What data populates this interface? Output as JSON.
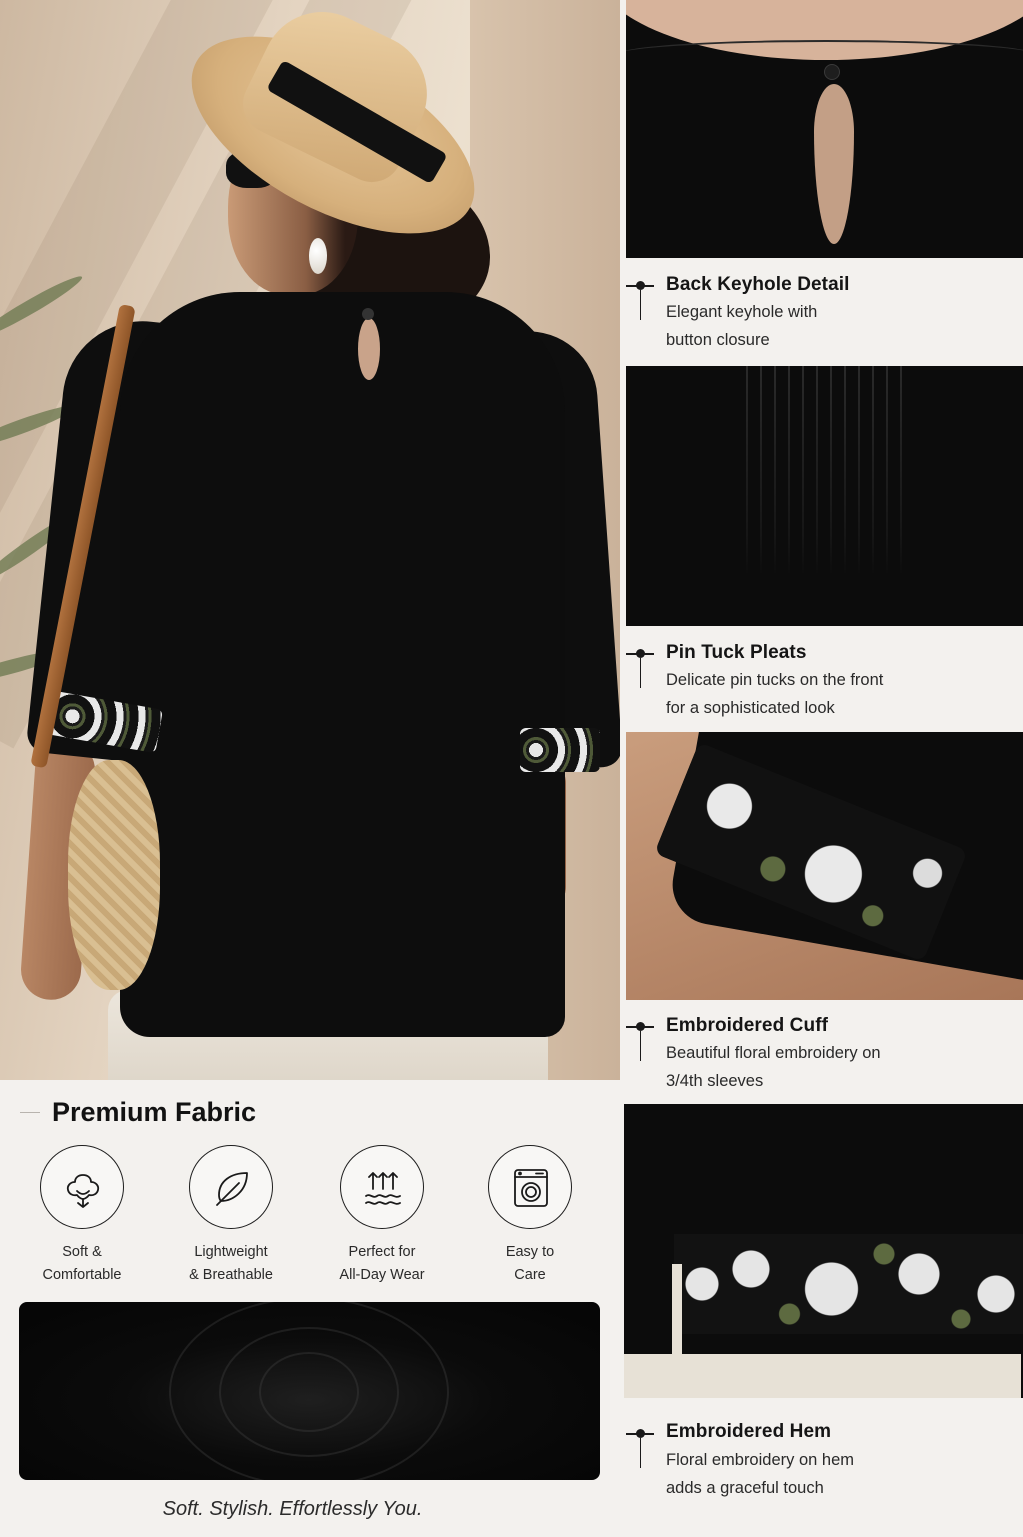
{
  "main_photo": {
    "description_icon": "woman-back-view-black-tunic"
  },
  "details": [
    {
      "title": "Back Keyhole Detail",
      "desc_line1": "Elegant keyhole with",
      "desc_line2": "button closure"
    },
    {
      "title": "Pin Tuck Pleats",
      "desc_line1": "Delicate pin tucks on the front",
      "desc_line2": "for a sophisticated look"
    },
    {
      "title": "Embroidered Cuff",
      "desc_line1": "Beautiful floral embroidery on",
      "desc_line2": "3/4th sleeves"
    },
    {
      "title": "Embroidered Hem",
      "desc_line1": "Floral embroidery on hem",
      "desc_line2": "adds a graceful touch"
    }
  ],
  "fabric": {
    "heading": "Premium Fabric",
    "features": [
      {
        "icon": "cotton-icon",
        "line1": "Soft &",
        "line2": "Comfortable"
      },
      {
        "icon": "leaf-icon",
        "line1": "Lightweight",
        "line2": "& Breathable"
      },
      {
        "icon": "airflow-icon",
        "line1": "Perfect for",
        "line2": "All-Day Wear"
      },
      {
        "icon": "washing-machine-icon",
        "line1": "Easy to",
        "line2": "Care"
      }
    ],
    "tagline": "Soft. Stylish. Effortlessly You."
  },
  "colors": {
    "background": "#f3f1ee",
    "fabric": "#0c0c0c",
    "text": "#1a1a1a"
  }
}
